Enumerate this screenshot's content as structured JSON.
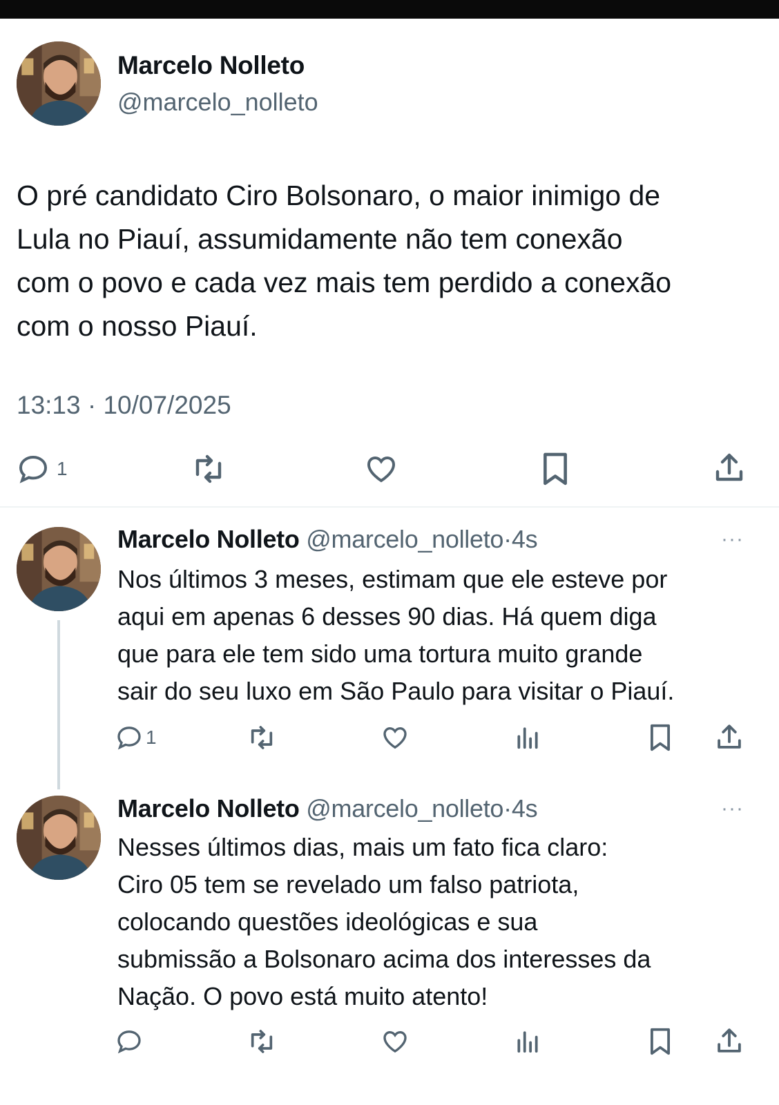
{
  "main_tweet": {
    "author_name": "Marcelo Nolleto",
    "author_handle": "@marcelo_nolleto",
    "text_lines": [
      "O pré candidato Ciro Bolsonaro, o maior inimigo de",
      "Lula no Piauí, assumidamente não tem conexão",
      "com o povo e cada vez mais tem perdido a conexão",
      "com o nosso Piauí."
    ],
    "timestamp": "13:13 · 10/07/2025",
    "reply_count": "1"
  },
  "replies": [
    {
      "author_name": "Marcelo Nolleto",
      "author_handle": "@marcelo_nolleto",
      "separator": "·",
      "time": "4s",
      "more": "···",
      "text_lines": [
        "Nos últimos 3 meses, estimam que ele esteve por",
        "aqui em apenas 6 desses 90 dias. Há quem diga",
        "que para ele tem sido uma tortura muito grande",
        "sair do seu luxo em São Paulo para visitar o Piauí."
      ],
      "reply_count": "1"
    },
    {
      "author_name": "Marcelo Nolleto",
      "author_handle": "@marcelo_nolleto",
      "separator": "·",
      "time": "4s",
      "more": "···",
      "text_lines": [
        "Nesses últimos dias, mais um fato fica claro:",
        "Ciro 05 tem se revelado um falso patriota,",
        "colocando questões ideológicas e sua",
        "submissão a Bolsonaro acima dos interesses da",
        "Nação. O povo está muito atento!"
      ],
      "reply_count": ""
    }
  ],
  "icons": [
    "reply-icon",
    "retweet-icon",
    "like-icon",
    "views-icon",
    "bookmark-icon",
    "share-icon",
    "more-icon"
  ]
}
